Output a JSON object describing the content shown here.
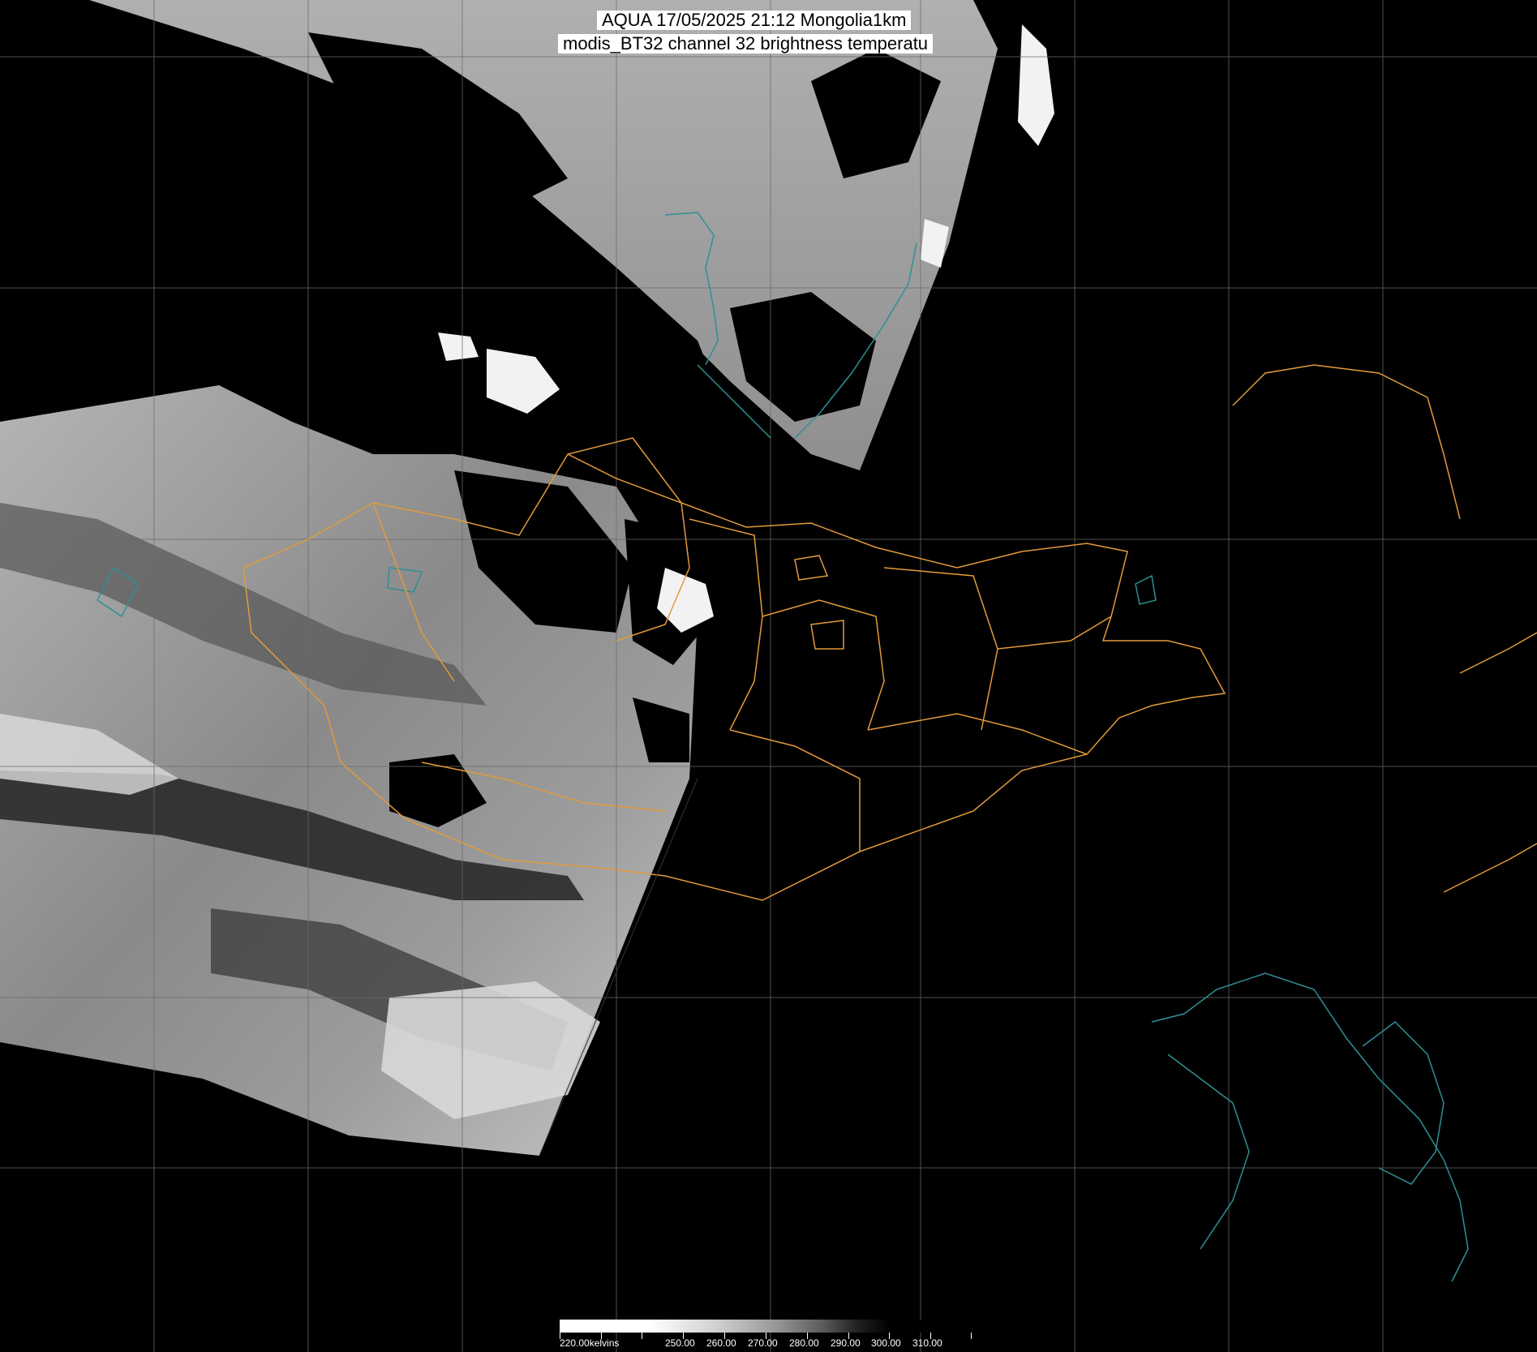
{
  "title": {
    "line1": "AQUA 17/05/2025 21:12 Mongolia1km",
    "line2": "modis_BT32 channel 32 brightness temperatu"
  },
  "colorbar": {
    "unit_label": "220.00kelvins",
    "tick_labels": [
      "250.00",
      "260.00",
      "270.00",
      "280.00",
      "290.00",
      "300.00",
      "310.00"
    ],
    "range_kelvin": [
      220,
      320
    ],
    "colormap": "white-cold to black-warm grayscale"
  },
  "map": {
    "region": "Mongolia",
    "sensor": "AQUA MODIS",
    "product": "modis_BT32",
    "graticule": true,
    "border_color": "#e39a3a",
    "coastline_color": "#2f8f95",
    "swath_gray": "#8a8a8a",
    "cloud_color": "#000000"
  }
}
